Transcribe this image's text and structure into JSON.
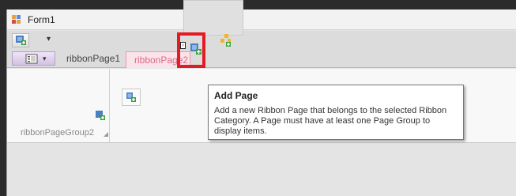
{
  "window": {
    "title": "Form1"
  },
  "qat": {
    "dropdown_glyph": "▾"
  },
  "ribbon": {
    "tabs": [
      {
        "label": "ribbonPage1"
      },
      {
        "label": "ribbonPage2"
      }
    ],
    "app_menu": {
      "arrow_glyph": "▾"
    },
    "groups": [
      {
        "caption": "ribbonPageGroup2"
      }
    ],
    "highlight_color": "#e31b23",
    "contextual_tab_color": "#d96a8a"
  },
  "tooltip": {
    "title": "Add Page",
    "body": "Add a new Ribbon Page that belongs to the selected Ribbon Category. A Page must have at least one Page Group to display items."
  },
  "icons": {
    "app": "app-icon",
    "qat_button": "add-page-icon",
    "app_menu": "menu-icon",
    "add_category": "add-category-icon",
    "add_page": "add-page-icon",
    "group_add": "add-group-icon",
    "launcher": "dialog-launcher-icon"
  }
}
